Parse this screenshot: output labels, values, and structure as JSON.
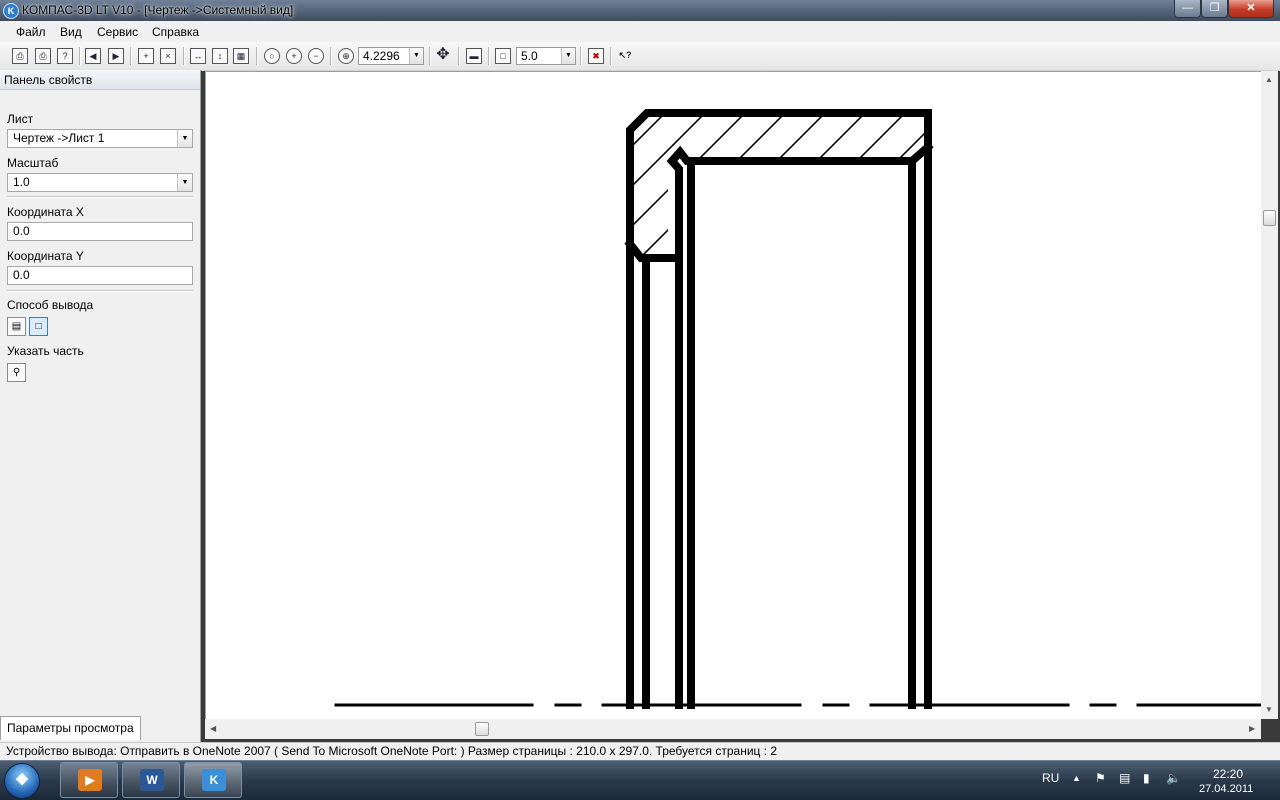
{
  "window": {
    "title": "КОМПАС-3D LT V10 - [Чертеж ->Системный вид]",
    "app_icon": "K"
  },
  "menu": [
    {
      "label": "Файл"
    },
    {
      "label": "Вид"
    },
    {
      "label": "Сервис"
    },
    {
      "label": "Справка"
    }
  ],
  "toolbar": {
    "zoom_value": "4.2296",
    "step_value": "5.0",
    "icons": [
      "print-icon",
      "print-preview-icon",
      "help-page-icon",
      "sheet-prev-icon",
      "sheet-next-icon",
      "copy-sheet-icon",
      "delete-sheet-icon",
      "fit-width-icon",
      "fit-height-icon",
      "fit-page-icon",
      "zoom-fit-icon",
      "zoom-in-icon",
      "zoom-out-icon",
      "zoom-window-icon",
      "pan-icon",
      "view-icon",
      "snap-step-icon",
      "close-preview-icon",
      "context-help-icon"
    ]
  },
  "panel": {
    "header": "Панель свойств",
    "sheet_label": "Лист",
    "sheet_value": "Чертеж ->Лист 1",
    "scale_label": "Масштаб",
    "scale_value": "1.0",
    "coord_x_label": "Координата X",
    "coord_x_value": "0.0",
    "coord_y_label": "Координата Y",
    "coord_y_value": "0.0",
    "output_mode_label": "Способ вывода",
    "select_part_label": "Указать часть",
    "tab_label": "Параметры просмотра"
  },
  "status": {
    "text": "Устройство вывода: Отправить в OneNote 2007 ( Send To Microsoft OneNote Port: )  Размер страницы : 210.0 x 297.0.  Требуется страниц : 2"
  },
  "taskbar": {
    "lang": "RU",
    "time": "22:20",
    "date": "27.04.2011",
    "apps": [
      {
        "name": "media-player-icon",
        "glyph": "▶",
        "color": "#e07b1f"
      },
      {
        "name": "word-icon",
        "glyph": "W",
        "color": "#2b5797"
      },
      {
        "name": "kompas-icon",
        "glyph": "K",
        "color": "#3a8fd6"
      }
    ]
  }
}
